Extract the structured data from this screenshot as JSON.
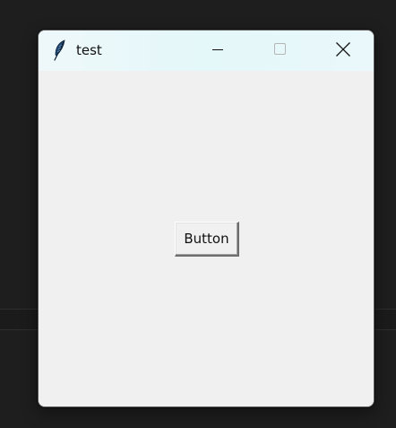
{
  "window": {
    "title": "test",
    "app_icon": "feather-icon",
    "controls": {
      "minimize_icon": "minimize-icon",
      "maximize_icon": "maximize-icon",
      "close_icon": "close-icon"
    }
  },
  "content": {
    "button_label": "Button"
  },
  "colors": {
    "desktop_bg": "#1e1e1e",
    "window_bg": "#f0f0f0",
    "titlebar_bg": "#e4f7f9"
  }
}
